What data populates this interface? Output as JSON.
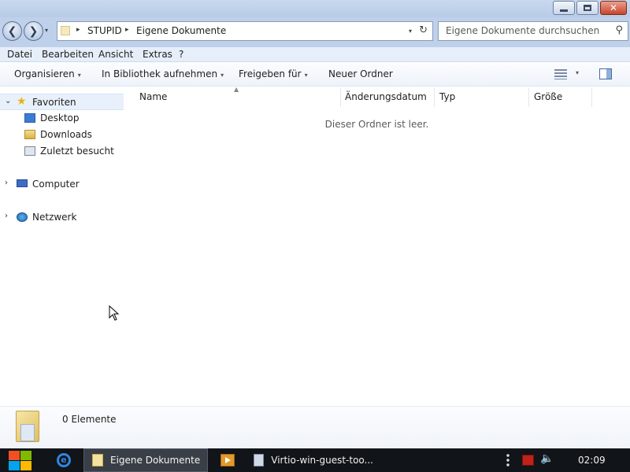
{
  "window": {
    "controls": {
      "minimize_icon": "minimize-icon",
      "maximize_icon": "restore-icon",
      "close_icon": "close-icon",
      "close_glyph": "✕"
    }
  },
  "navigation": {
    "back_glyph": "❮",
    "forward_glyph": "❯",
    "address": {
      "parts": [
        "STUPID",
        "Eigene Dokumente"
      ],
      "separator": "▸",
      "dropdown": "▾",
      "refresh": "↻"
    },
    "search": {
      "placeholder": "Eigene Dokumente durchsuchen",
      "icon": "⚲"
    }
  },
  "menubar": {
    "items": [
      "Datei",
      "Bearbeiten",
      "Ansicht",
      "Extras",
      "?"
    ]
  },
  "toolbar": {
    "organize": "Organisieren",
    "include_library": "In Bibliothek aufnehmen",
    "share_with": "Freigeben für",
    "new_folder": "Neuer Ordner",
    "caret": "▾"
  },
  "sidebar": {
    "favorites": {
      "label": "Favoriten",
      "items": [
        "Desktop",
        "Downloads",
        "Zuletzt besucht"
      ]
    },
    "computer": "Computer",
    "network": "Netzwerk",
    "expanded_glyph": "⌄",
    "collapsed_glyph": "›"
  },
  "content": {
    "columns": [
      "Name",
      "Änderungsdatum",
      "Typ",
      "Größe"
    ],
    "sort_glyph": "▲",
    "empty_message": "Dieser Ordner ist leer."
  },
  "details": {
    "item_count": "0 Elemente"
  },
  "taskbar": {
    "buttons": [
      {
        "label": "Eigene Dokumente",
        "active": true
      },
      {
        "label": "Virtio-win-guest-too...",
        "active": false
      }
    ],
    "clock": "02:09",
    "colors": {
      "flag_red": "#f25022",
      "flag_green": "#7fba00",
      "flag_blue": "#00a4ef",
      "flag_yellow": "#ffb900"
    }
  }
}
